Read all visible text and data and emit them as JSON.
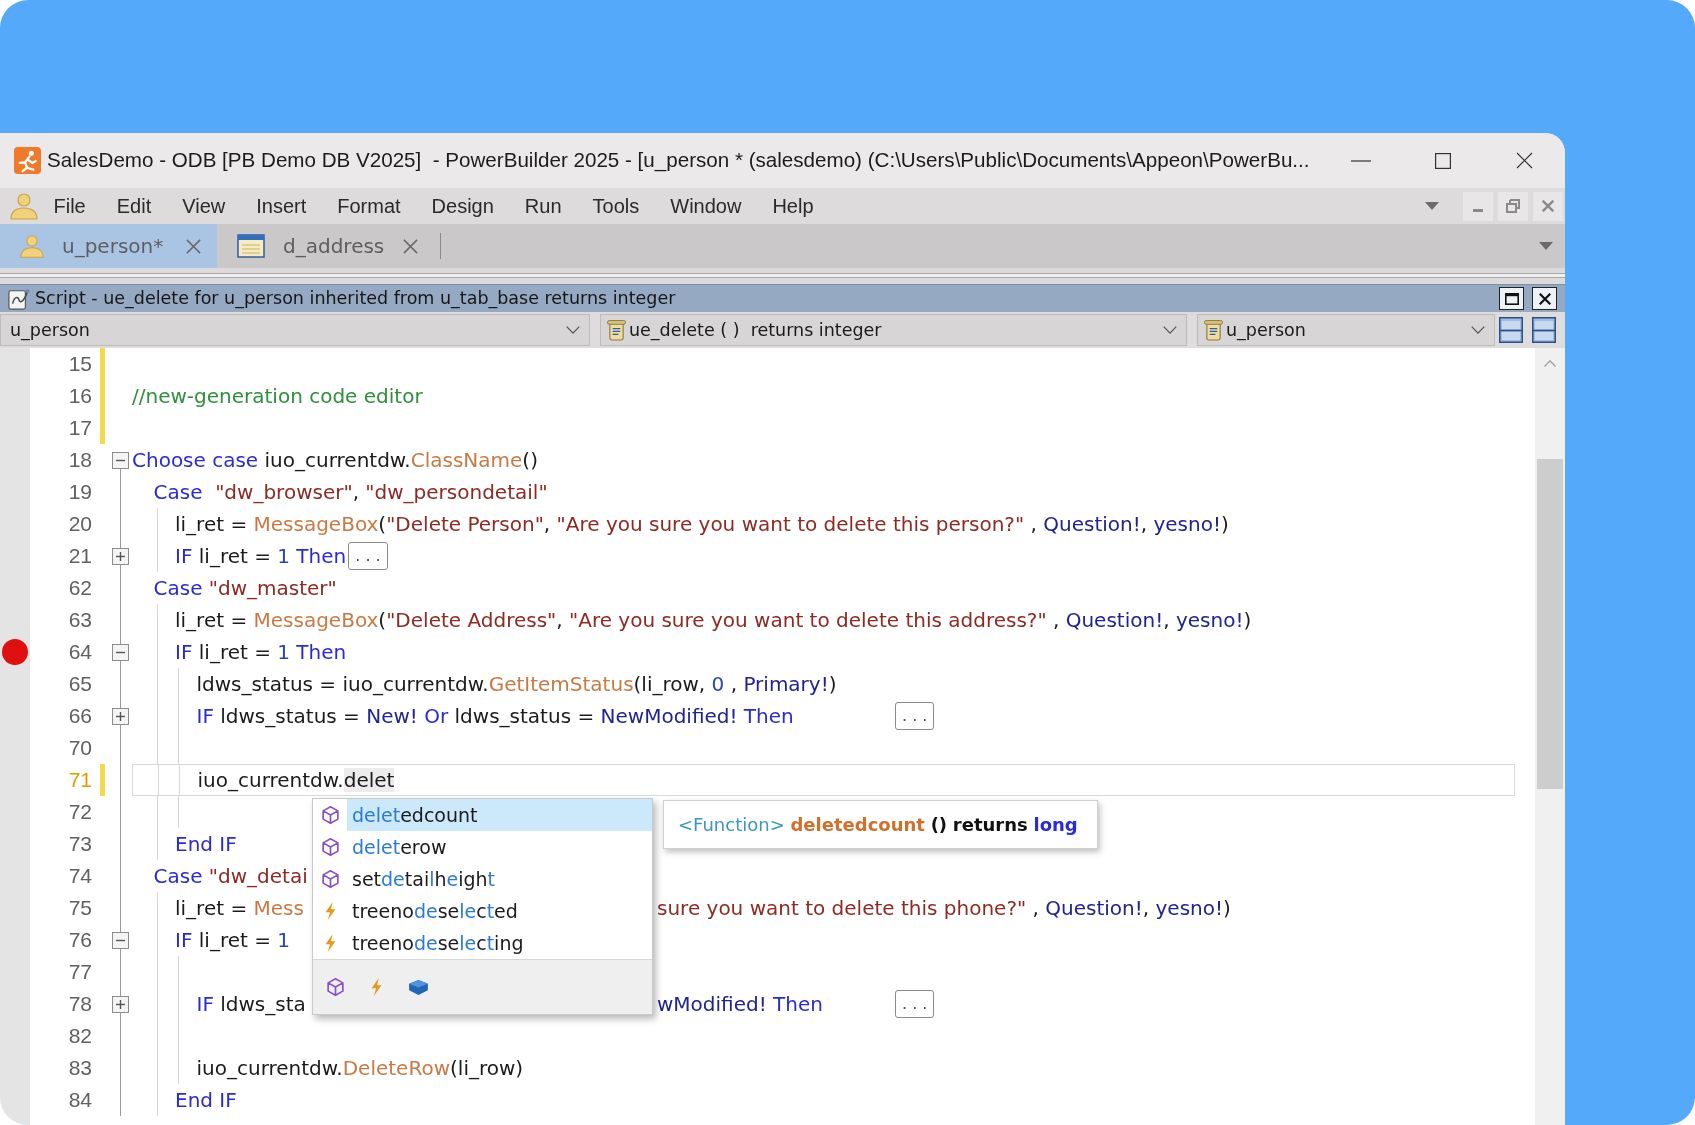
{
  "window": {
    "title": "SalesDemo - ODB [PB Demo DB V2025]  - PowerBuilder 2025 - [u_person * (salesdemo) (C:\\Users\\Public\\Documents\\Appeon\\PowerBu..."
  },
  "menu": [
    {
      "label": "File"
    },
    {
      "label": "Edit"
    },
    {
      "label": "View"
    },
    {
      "label": "Insert"
    },
    {
      "label": "Format"
    },
    {
      "label": "Design"
    },
    {
      "label": "Run"
    },
    {
      "label": "Tools"
    },
    {
      "label": "Window"
    },
    {
      "label": "Help"
    }
  ],
  "tabs": [
    {
      "label": "u_person*",
      "kind": "user_object",
      "selected": true
    },
    {
      "label": "d_address",
      "kind": "datawindow",
      "selected": false
    }
  ],
  "script_pane": {
    "title": "Script - ue_delete for u_person inherited from u_tab_base returns integer",
    "selectors": [
      {
        "value": "u_person",
        "kind": "plain"
      },
      {
        "value": "ue_delete ( )  returns integer",
        "kind": "script"
      },
      {
        "value": "u_person",
        "kind": "script"
      }
    ]
  },
  "editor": {
    "lines": [
      {
        "number": "15",
        "modified": true,
        "breakpoint": false,
        "current": false
      },
      {
        "number": "16",
        "modified": true,
        "breakpoint": false,
        "current": false,
        "tokens": [
          {
            "kind": "comment",
            "text": "//new-generation code editor"
          }
        ]
      },
      {
        "number": "17",
        "modified": true,
        "breakpoint": false,
        "current": false
      },
      {
        "number": "18",
        "modified": false,
        "breakpoint": false,
        "current": false,
        "expanded": true,
        "tokens": [
          {
            "kind": "keyword",
            "text": "Choose case"
          },
          {
            "kind": "text",
            "text": " iuo_currentdw."
          },
          {
            "kind": "function",
            "text": "ClassName"
          },
          {
            "kind": "text",
            "text": "()"
          }
        ],
        "children": [
          {
            "number": "19",
            "modified": false,
            "breakpoint": false,
            "current": false,
            "tokens": [
              {
                "kind": "keyword",
                "text": "Case"
              },
              {
                "kind": "string",
                "text": "  \"dw_browser\""
              },
              {
                "kind": "text",
                "text": ", "
              },
              {
                "kind": "string",
                "text": "\"dw_persondetail\""
              }
            ],
            "children": [
              {
                "number": "20",
                "modified": false,
                "breakpoint": false,
                "current": false,
                "tokens": [
                  {
                    "kind": "text",
                    "text": "li_ret = "
                  },
                  {
                    "kind": "function",
                    "text": "MessageBox"
                  },
                  {
                    "kind": "text",
                    "text": "("
                  },
                  {
                    "kind": "string",
                    "text": "\"Delete Person\""
                  },
                  {
                    "kind": "text",
                    "text": ", "
                  },
                  {
                    "kind": "string",
                    "text": "\"Are you sure you want to delete this person?\""
                  },
                  {
                    "kind": "text",
                    "text": " , "
                  },
                  {
                    "kind": "constant",
                    "text": "Question!"
                  },
                  {
                    "kind": "text",
                    "text": ", "
                  },
                  {
                    "kind": "constant",
                    "text": "yesno!"
                  },
                  {
                    "kind": "text",
                    "text": ")"
                  }
                ]
              },
              {
                "number": "21",
                "modified": false,
                "breakpoint": false,
                "current": false,
                "expanded": false,
                "tokens": [
                  {
                    "kind": "keyword",
                    "text": "IF"
                  },
                  {
                    "kind": "text",
                    "text": " li_ret = "
                  },
                  {
                    "kind": "number",
                    "text": "1"
                  },
                  {
                    "kind": "keyword",
                    "text": " Then"
                  }
                ],
                "ellipsis": ". . .",
                "ellipsis_at_tab": false
              }
            ]
          },
          {
            "number": "62",
            "modified": false,
            "breakpoint": false,
            "current": false,
            "tokens": [
              {
                "kind": "keyword",
                "text": "Case"
              },
              {
                "kind": "string",
                "text": " \"dw_master\""
              }
            ],
            "children": [
              {
                "number": "63",
                "modified": false,
                "breakpoint": false,
                "current": false,
                "tokens": [
                  {
                    "kind": "text",
                    "text": "li_ret = "
                  },
                  {
                    "kind": "function",
                    "text": "MessageBox"
                  },
                  {
                    "kind": "text",
                    "text": "("
                  },
                  {
                    "kind": "string",
                    "text": "\"Delete Address\""
                  },
                  {
                    "kind": "text",
                    "text": ", "
                  },
                  {
                    "kind": "string",
                    "text": "\"Are you sure you want to delete this address?\""
                  },
                  {
                    "kind": "text",
                    "text": " , "
                  },
                  {
                    "kind": "constant",
                    "text": "Question!"
                  },
                  {
                    "kind": "text",
                    "text": ", "
                  },
                  {
                    "kind": "constant",
                    "text": "yesno!"
                  },
                  {
                    "kind": "text",
                    "text": ")"
                  }
                ]
              },
              {
                "number": "64",
                "modified": false,
                "breakpoint": true,
                "current": false,
                "expanded": true,
                "tokens": [
                  {
                    "kind": "keyword",
                    "text": "IF"
                  },
                  {
                    "kind": "text",
                    "text": " li_ret = "
                  },
                  {
                    "kind": "number",
                    "text": "1"
                  },
                  {
                    "kind": "keyword",
                    "text": " Then"
                  }
                ],
                "children": [
                  {
                    "number": "65",
                    "modified": false,
                    "breakpoint": false,
                    "current": false,
                    "tokens": [
                      {
                        "kind": "text",
                        "text": "ldws_status = iuo_currentdw."
                      },
                      {
                        "kind": "function",
                        "text": "GetItemStatus"
                      },
                      {
                        "kind": "text",
                        "text": "(li_row, "
                      },
                      {
                        "kind": "number",
                        "text": "0"
                      },
                      {
                        "kind": "text",
                        "text": " , "
                      },
                      {
                        "kind": "constant",
                        "text": "Primary!"
                      },
                      {
                        "kind": "text",
                        "text": ")"
                      }
                    ]
                  },
                  {
                    "number": "66",
                    "modified": false,
                    "breakpoint": false,
                    "current": false,
                    "expanded": false,
                    "tokens": [
                      {
                        "kind": "keyword",
                        "text": "IF"
                      },
                      {
                        "kind": "text",
                        "text": " ldws_status = "
                      },
                      {
                        "kind": "constant",
                        "text": "New!"
                      },
                      {
                        "kind": "keyword",
                        "text": " Or"
                      },
                      {
                        "kind": "text",
                        "text": " ldws_status = "
                      },
                      {
                        "kind": "constant",
                        "text": "NewModified!"
                      },
                      {
                        "kind": "keyword",
                        "text": " Then"
                      }
                    ],
                    "ellipsis": ". . .",
                    "ellipsis_at_tab": true
                  },
                  {
                    "number": "70",
                    "modified": false,
                    "breakpoint": false,
                    "current": false
                  },
                  {
                    "number": "71",
                    "modified": true,
                    "breakpoint": false,
                    "current": true,
                    "tokens": [
                      {
                        "kind": "text",
                        "text": "iuo_currentdw."
                      },
                      {
                        "kind": "typed",
                        "text": "delet"
                      }
                    ]
                  },
                  {
                    "number": "72",
                    "modified": false,
                    "breakpoint": false,
                    "current": false
                  }
                ]
              },
              {
                "number": "73",
                "modified": false,
                "breakpoint": false,
                "current": false,
                "tokens": [
                  {
                    "kind": "keyword",
                    "text": "End IF"
                  }
                ]
              }
            ]
          },
          {
            "number": "74",
            "modified": false,
            "breakpoint": false,
            "current": false,
            "tokens": [
              {
                "kind": "keyword",
                "text": "Case"
              },
              {
                "kind": "string",
                "text": " \"dw_detai"
              }
            ],
            "children": [
              {
                "number": "75",
                "modified": false,
                "breakpoint": false,
                "current": false,
                "tokens": [
                  {
                    "kind": "text",
                    "text": "li_ret = "
                  },
                  {
                    "kind": "function",
                    "text": "Mess"
                  }
                ],
                "tail": [
                  {
                    "kind": "string",
                    "text": "sure you want to delete this phone?\""
                  },
                  {
                    "kind": "text",
                    "text": " , "
                  },
                  {
                    "kind": "constant",
                    "text": "Question!"
                  },
                  {
                    "kind": "text",
                    "text": ", "
                  },
                  {
                    "kind": "constant",
                    "text": "yesno!"
                  },
                  {
                    "kind": "text",
                    "text": ")"
                  }
                ]
              },
              {
                "number": "76",
                "modified": false,
                "breakpoint": false,
                "current": false,
                "expanded": true,
                "tokens": [
                  {
                    "kind": "keyword",
                    "text": "IF"
                  },
                  {
                    "kind": "text",
                    "text": " li_ret = "
                  },
                  {
                    "kind": "number",
                    "text": "1"
                  }
                ],
                "children": [
                  {
                    "number": "77",
                    "modified": false,
                    "breakpoint": false,
                    "current": false
                  },
                  {
                    "number": "78",
                    "modified": false,
                    "breakpoint": false,
                    "current": false,
                    "expanded": false,
                    "tokens": [
                      {
                        "kind": "keyword",
                        "text": "IF"
                      },
                      {
                        "kind": "text",
                        "text": " ldws_sta"
                      }
                    ],
                    "tail": [
                      {
                        "kind": "constant",
                        "text": "wModified!"
                      },
                      {
                        "kind": "keyword",
                        "text": " Then"
                      }
                    ],
                    "ellipsis": ". . .",
                    "ellipsis_at_tab": true
                  },
                  {
                    "number": "82",
                    "modified": false,
                    "breakpoint": false,
                    "current": false
                  },
                  {
                    "number": "83",
                    "modified": false,
                    "breakpoint": false,
                    "current": false,
                    "tokens": [
                      {
                        "kind": "text",
                        "text": "iuo_currentdw."
                      },
                      {
                        "kind": "function",
                        "text": "DeleteRow"
                      },
                      {
                        "kind": "text",
                        "text": "(li_row)"
                      }
                    ]
                  }
                ]
              },
              {
                "number": "84",
                "modified": false,
                "breakpoint": false,
                "current": false,
                "tokens": [
                  {
                    "kind": "keyword",
                    "text": "End IF"
                  }
                ]
              }
            ]
          }
        ]
      }
    ]
  },
  "autocomplete": {
    "items": [
      {
        "kind": "function",
        "selected": true,
        "segments": [
          {
            "text": "delet",
            "match": true
          },
          {
            "text": "edcount",
            "match": false
          }
        ]
      },
      {
        "kind": "function",
        "selected": false,
        "segments": [
          {
            "text": "delet",
            "match": true
          },
          {
            "text": "erow",
            "match": false
          }
        ]
      },
      {
        "kind": "function",
        "selected": false,
        "segments": [
          {
            "text": "set",
            "match": false
          },
          {
            "text": "de",
            "match": true
          },
          {
            "text": "tai",
            "match": false
          },
          {
            "text": "l",
            "match": true
          },
          {
            "text": "h",
            "match": false
          },
          {
            "text": "e",
            "match": true
          },
          {
            "text": "igh",
            "match": false
          },
          {
            "text": "t",
            "match": true
          }
        ]
      },
      {
        "kind": "event",
        "selected": false,
        "segments": [
          {
            "text": "treeno",
            "match": false
          },
          {
            "text": "de",
            "match": true
          },
          {
            "text": "se",
            "match": false
          },
          {
            "text": "le",
            "match": true
          },
          {
            "text": "c",
            "match": false
          },
          {
            "text": "t",
            "match": true
          },
          {
            "text": "ed",
            "match": false
          }
        ]
      },
      {
        "kind": "event",
        "selected": false,
        "segments": [
          {
            "text": "treeno",
            "match": false
          },
          {
            "text": "de",
            "match": true
          },
          {
            "text": "se",
            "match": false
          },
          {
            "text": "le",
            "match": true
          },
          {
            "text": "c",
            "match": false
          },
          {
            "text": "t",
            "match": true
          },
          {
            "text": "ing",
            "match": false
          }
        ]
      }
    ],
    "filters": [
      {
        "kind": "function"
      },
      {
        "kind": "event"
      },
      {
        "kind": "property"
      }
    ]
  },
  "tooltip": {
    "tokens": [
      {
        "kind": "category",
        "text": "<Function>"
      },
      {
        "kind": "name",
        "text": "deletedcount"
      },
      {
        "kind": "punct",
        "text": "()"
      },
      {
        "kind": "keyword",
        "text": "returns"
      },
      {
        "kind": "type",
        "text": "long"
      }
    ]
  }
}
